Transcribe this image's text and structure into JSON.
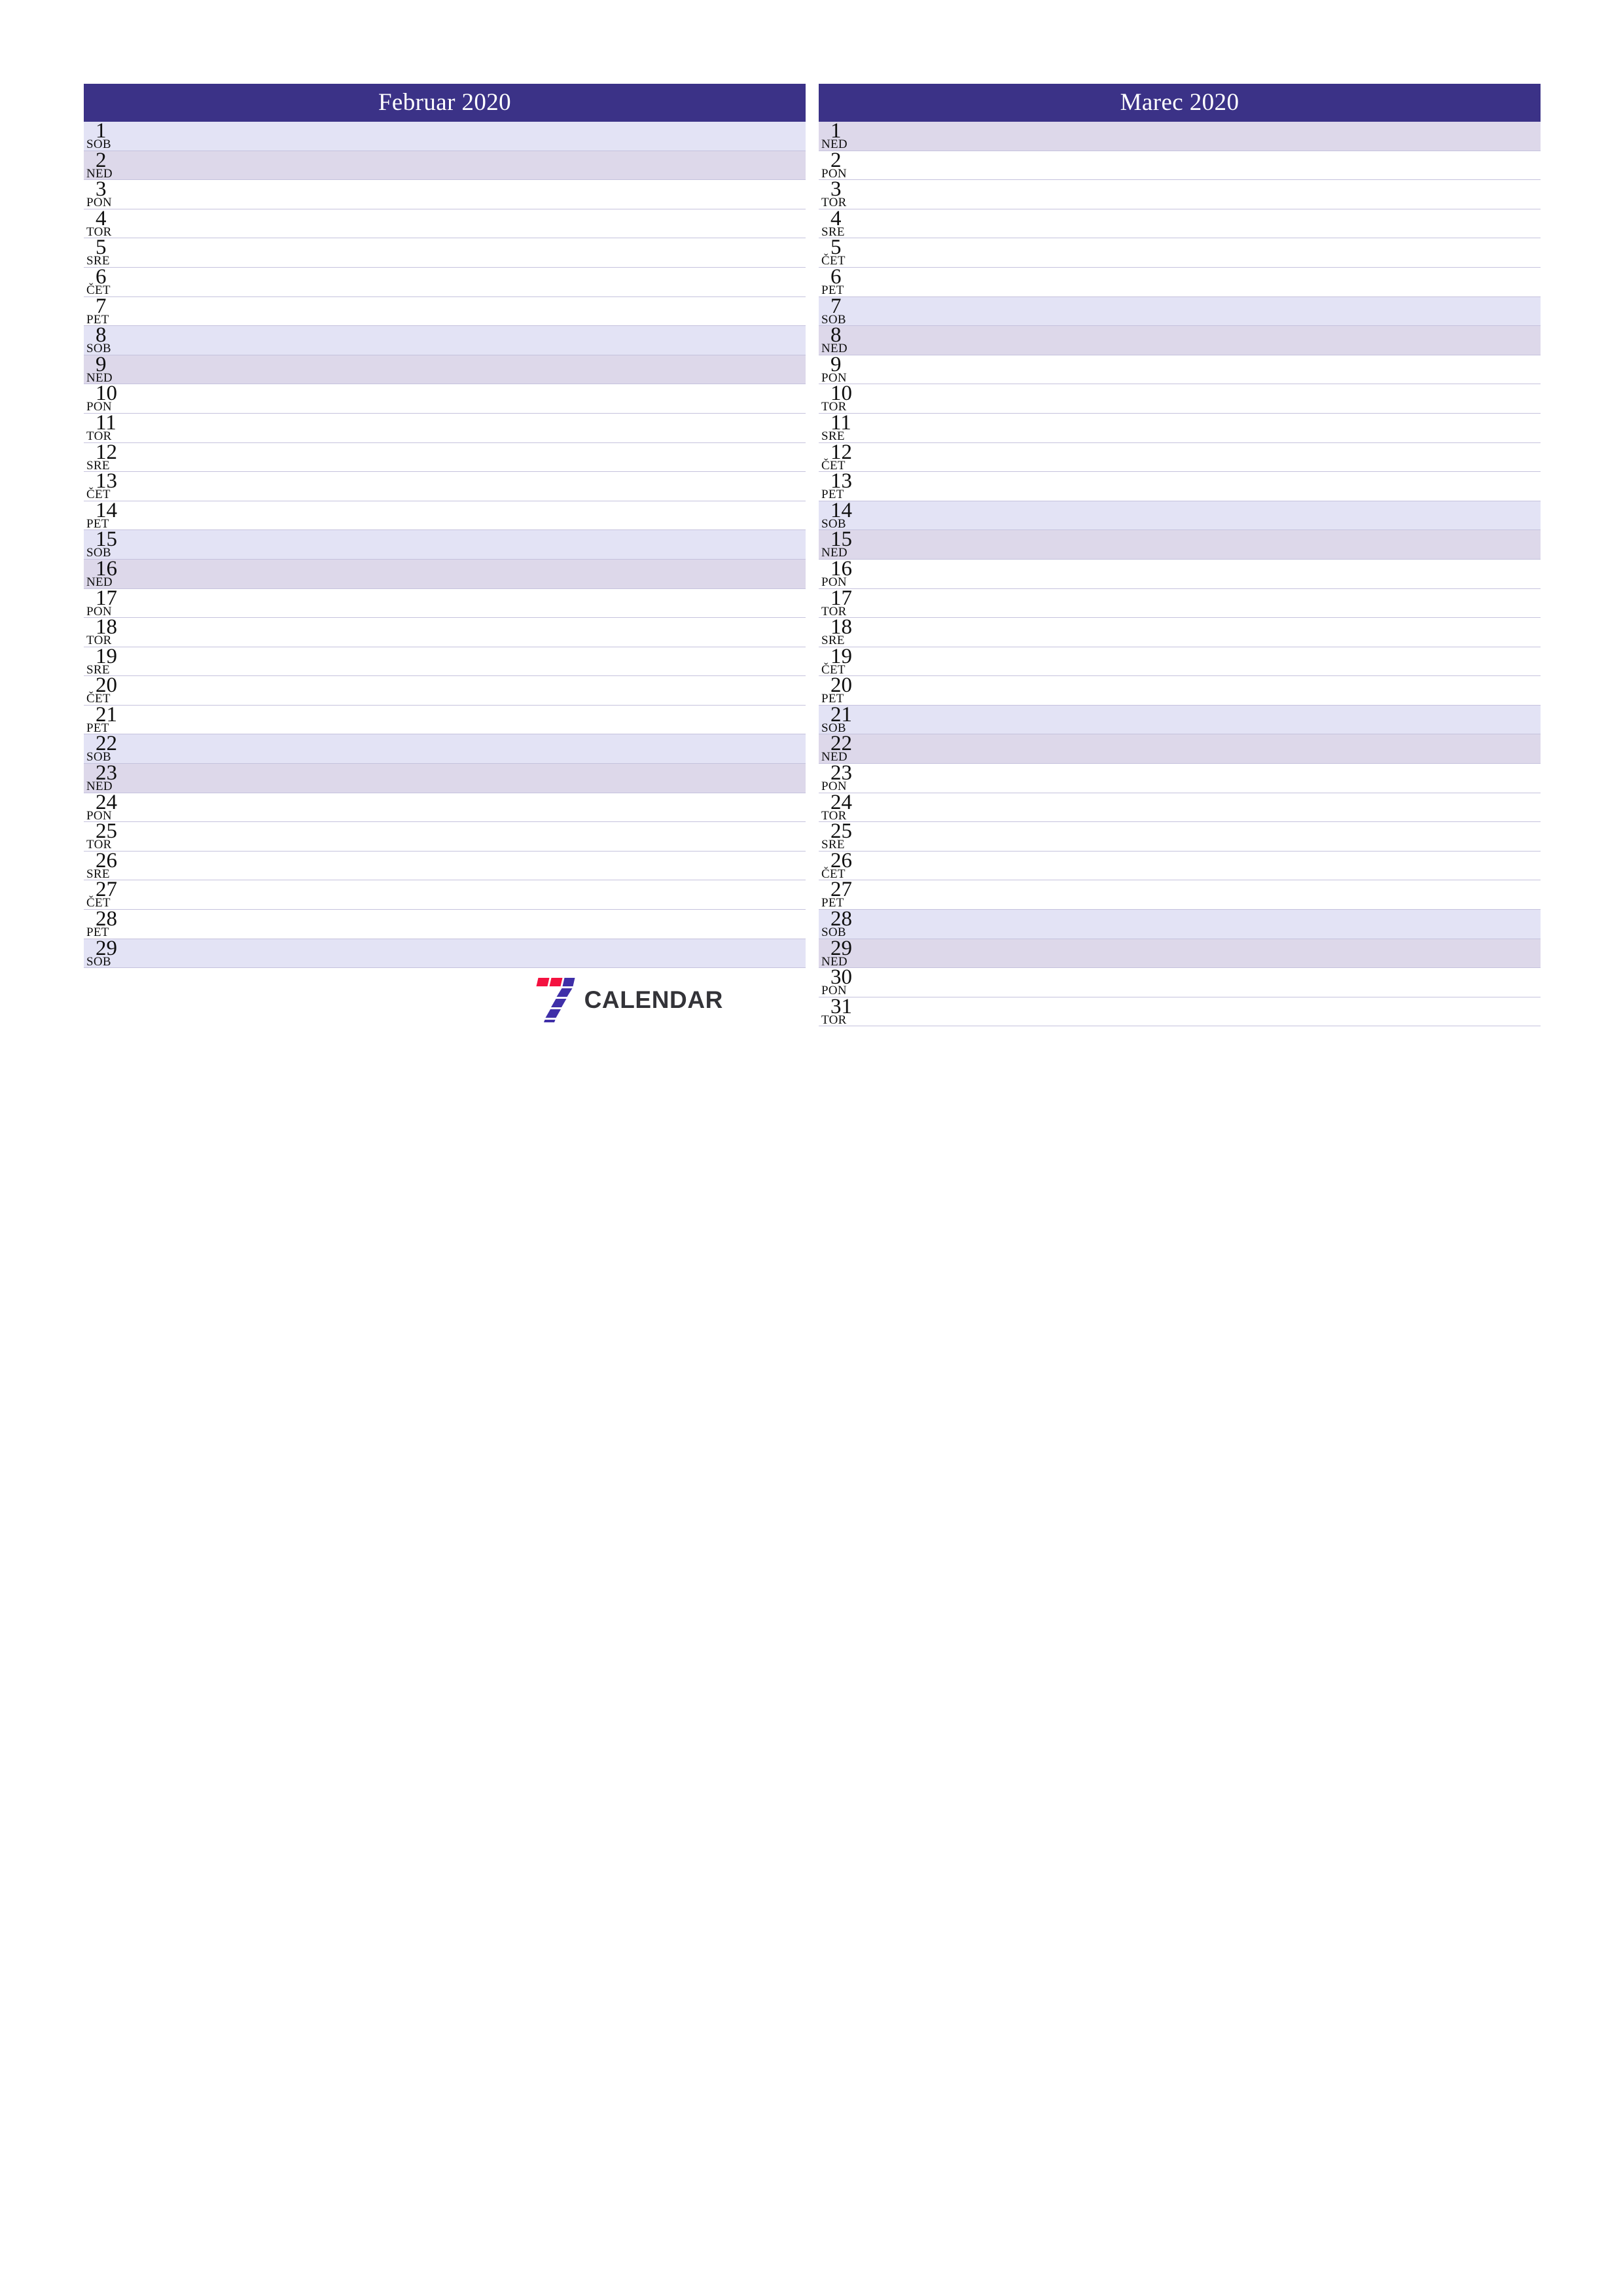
{
  "document": {
    "kind": "two-month-planner",
    "language": "Slovenian",
    "page_size": "A4 portrait"
  },
  "theme": {
    "header_bg": "#3b3287",
    "header_text": "#ffffff",
    "saturday_bg": "#e3e3f5",
    "sunday_bg": "#ddd8ea",
    "weekday_bg": "#ffffff",
    "row_divider": "#c5c2dd",
    "day_text": "#101010",
    "logo_red": "#f4113f",
    "logo_blue": "#3f2fa8",
    "logo_word": "#333338"
  },
  "brand": {
    "mark_icon": "seven-blocks-logo",
    "word": "CALENDAR"
  },
  "months": [
    {
      "title": "Februar 2020",
      "name": "Februar",
      "year": "2020",
      "days": [
        {
          "num": "1",
          "dow": "SOB",
          "type": "sat"
        },
        {
          "num": "2",
          "dow": "NED",
          "type": "sun"
        },
        {
          "num": "3",
          "dow": "PON",
          "type": "weekday"
        },
        {
          "num": "4",
          "dow": "TOR",
          "type": "weekday"
        },
        {
          "num": "5",
          "dow": "SRE",
          "type": "weekday"
        },
        {
          "num": "6",
          "dow": "ČET",
          "type": "weekday"
        },
        {
          "num": "7",
          "dow": "PET",
          "type": "weekday"
        },
        {
          "num": "8",
          "dow": "SOB",
          "type": "sat"
        },
        {
          "num": "9",
          "dow": "NED",
          "type": "sun"
        },
        {
          "num": "10",
          "dow": "PON",
          "type": "weekday"
        },
        {
          "num": "11",
          "dow": "TOR",
          "type": "weekday"
        },
        {
          "num": "12",
          "dow": "SRE",
          "type": "weekday"
        },
        {
          "num": "13",
          "dow": "ČET",
          "type": "weekday"
        },
        {
          "num": "14",
          "dow": "PET",
          "type": "weekday"
        },
        {
          "num": "15",
          "dow": "SOB",
          "type": "sat"
        },
        {
          "num": "16",
          "dow": "NED",
          "type": "sun"
        },
        {
          "num": "17",
          "dow": "PON",
          "type": "weekday"
        },
        {
          "num": "18",
          "dow": "TOR",
          "type": "weekday"
        },
        {
          "num": "19",
          "dow": "SRE",
          "type": "weekday"
        },
        {
          "num": "20",
          "dow": "ČET",
          "type": "weekday"
        },
        {
          "num": "21",
          "dow": "PET",
          "type": "weekday"
        },
        {
          "num": "22",
          "dow": "SOB",
          "type": "sat"
        },
        {
          "num": "23",
          "dow": "NED",
          "type": "sun"
        },
        {
          "num": "24",
          "dow": "PON",
          "type": "weekday"
        },
        {
          "num": "25",
          "dow": "TOR",
          "type": "weekday"
        },
        {
          "num": "26",
          "dow": "SRE",
          "type": "weekday"
        },
        {
          "num": "27",
          "dow": "ČET",
          "type": "weekday"
        },
        {
          "num": "28",
          "dow": "PET",
          "type": "weekday"
        },
        {
          "num": "29",
          "dow": "SOB",
          "type": "sat"
        }
      ]
    },
    {
      "title": "Marec 2020",
      "name": "Marec",
      "year": "2020",
      "days": [
        {
          "num": "1",
          "dow": "NED",
          "type": "sun"
        },
        {
          "num": "2",
          "dow": "PON",
          "type": "weekday"
        },
        {
          "num": "3",
          "dow": "TOR",
          "type": "weekday"
        },
        {
          "num": "4",
          "dow": "SRE",
          "type": "weekday"
        },
        {
          "num": "5",
          "dow": "ČET",
          "type": "weekday"
        },
        {
          "num": "6",
          "dow": "PET",
          "type": "weekday"
        },
        {
          "num": "7",
          "dow": "SOB",
          "type": "sat"
        },
        {
          "num": "8",
          "dow": "NED",
          "type": "sun"
        },
        {
          "num": "9",
          "dow": "PON",
          "type": "weekday"
        },
        {
          "num": "10",
          "dow": "TOR",
          "type": "weekday"
        },
        {
          "num": "11",
          "dow": "SRE",
          "type": "weekday"
        },
        {
          "num": "12",
          "dow": "ČET",
          "type": "weekday"
        },
        {
          "num": "13",
          "dow": "PET",
          "type": "weekday"
        },
        {
          "num": "14",
          "dow": "SOB",
          "type": "sat"
        },
        {
          "num": "15",
          "dow": "NED",
          "type": "sun"
        },
        {
          "num": "16",
          "dow": "PON",
          "type": "weekday"
        },
        {
          "num": "17",
          "dow": "TOR",
          "type": "weekday"
        },
        {
          "num": "18",
          "dow": "SRE",
          "type": "weekday"
        },
        {
          "num": "19",
          "dow": "ČET",
          "type": "weekday"
        },
        {
          "num": "20",
          "dow": "PET",
          "type": "weekday"
        },
        {
          "num": "21",
          "dow": "SOB",
          "type": "sat"
        },
        {
          "num": "22",
          "dow": "NED",
          "type": "sun"
        },
        {
          "num": "23",
          "dow": "PON",
          "type": "weekday"
        },
        {
          "num": "24",
          "dow": "TOR",
          "type": "weekday"
        },
        {
          "num": "25",
          "dow": "SRE",
          "type": "weekday"
        },
        {
          "num": "26",
          "dow": "ČET",
          "type": "weekday"
        },
        {
          "num": "27",
          "dow": "PET",
          "type": "weekday"
        },
        {
          "num": "28",
          "dow": "SOB",
          "type": "sat"
        },
        {
          "num": "29",
          "dow": "NED",
          "type": "sun"
        },
        {
          "num": "30",
          "dow": "PON",
          "type": "weekday"
        },
        {
          "num": "31",
          "dow": "TOR",
          "type": "weekday"
        }
      ]
    }
  ]
}
